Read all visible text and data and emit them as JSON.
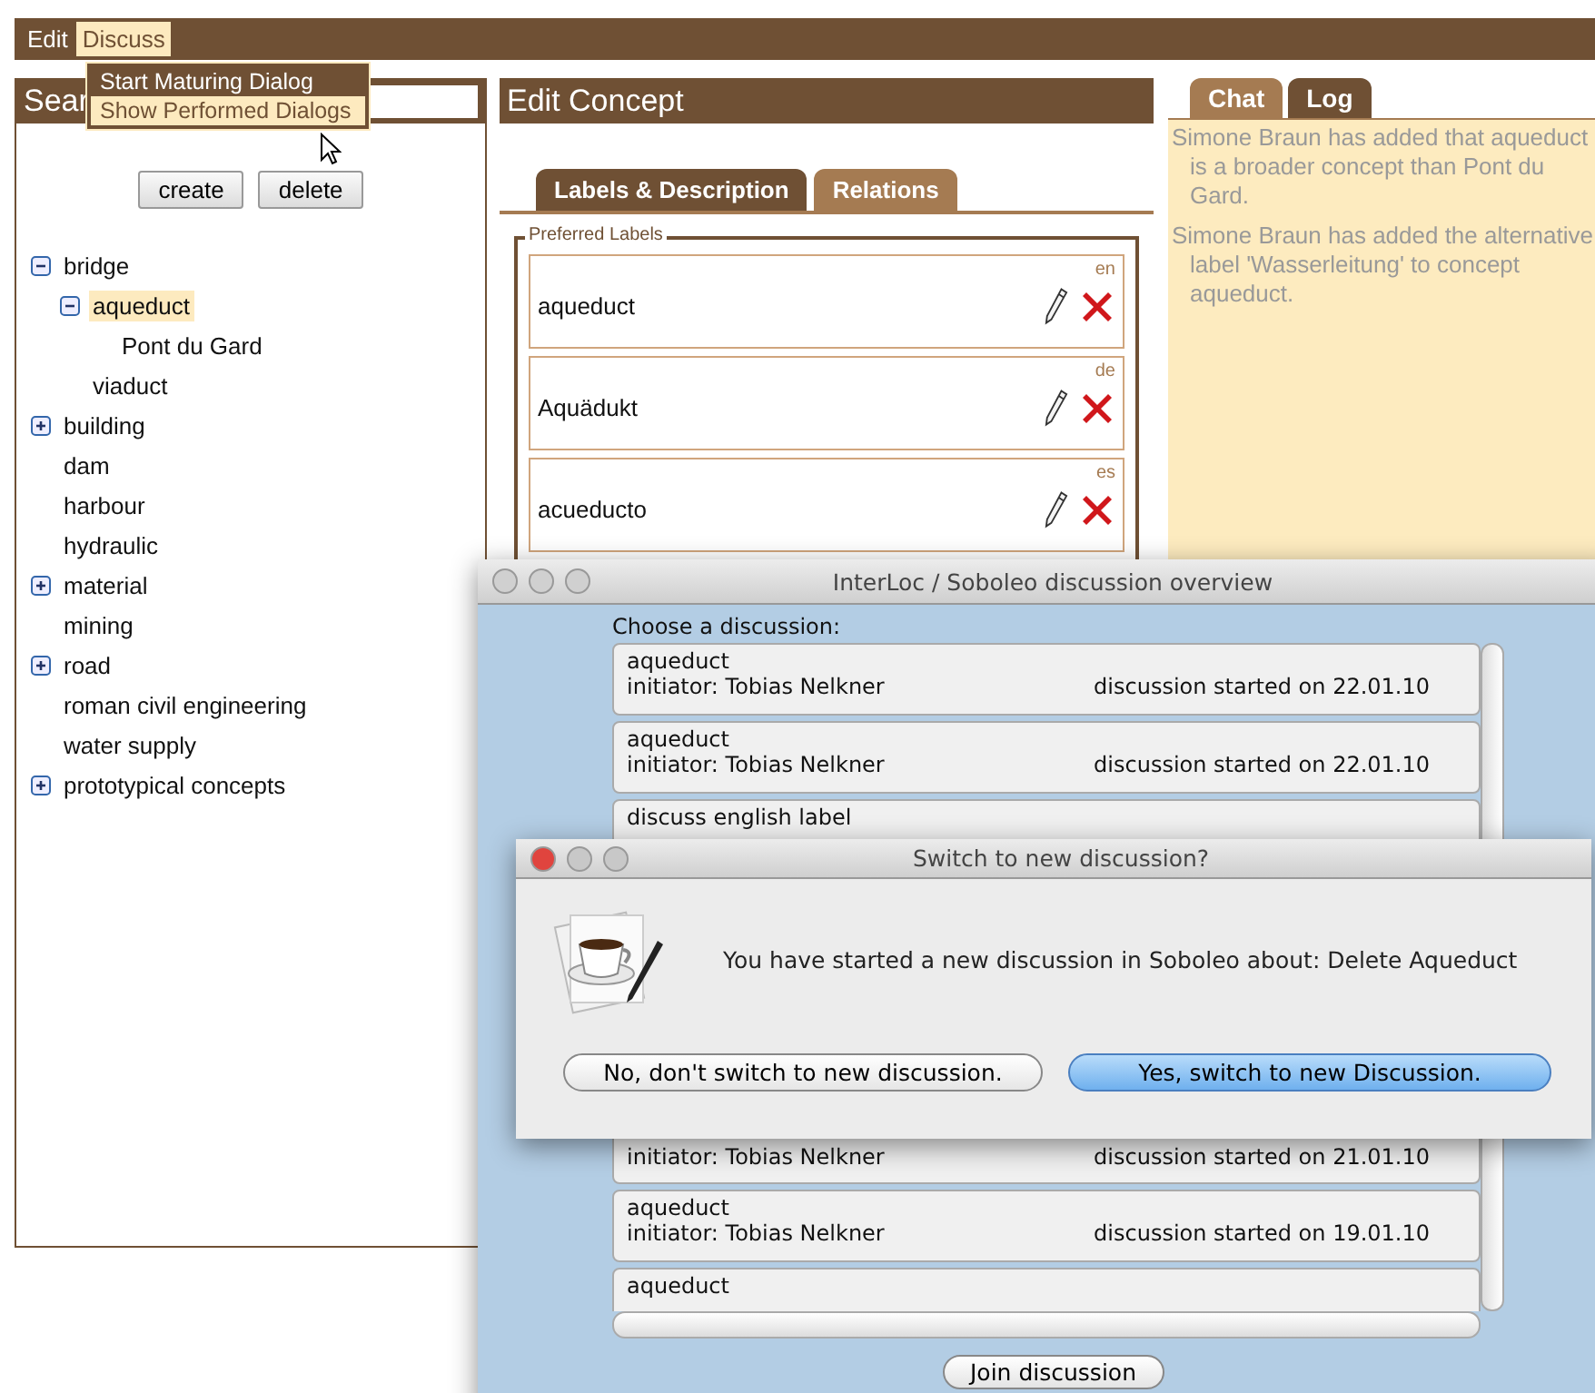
{
  "menu_bar": {
    "items": [
      {
        "label": "Edit",
        "selected": false
      },
      {
        "label": "Discuss",
        "selected": true
      }
    ]
  },
  "dropdown": {
    "items": [
      {
        "label": "Start Maturing Dialog",
        "selected": false
      },
      {
        "label": "Show Performed Dialogs",
        "selected": true
      }
    ]
  },
  "search_panel": {
    "title": "Sear",
    "buttons": [
      "create",
      "delete"
    ],
    "tree": [
      {
        "label": "bridge",
        "expanded": true,
        "selected": false,
        "children": [
          {
            "label": "aqueduct",
            "expanded": true,
            "selected": true,
            "children": [
              {
                "label": "Pont du Gard",
                "selected": false
              }
            ]
          },
          {
            "label": "viaduct",
            "selected": false
          }
        ]
      },
      {
        "label": "building",
        "expanded": false,
        "selected": false
      },
      {
        "label": "dam",
        "selected": false
      },
      {
        "label": "harbour",
        "selected": false
      },
      {
        "label": "hydraulic",
        "selected": false
      },
      {
        "label": "material",
        "expanded": false,
        "selected": false
      },
      {
        "label": "mining",
        "selected": false
      },
      {
        "label": "road",
        "expanded": false,
        "selected": false
      },
      {
        "label": "roman civil engineering",
        "selected": false
      },
      {
        "label": "water supply",
        "selected": false
      },
      {
        "label": "prototypical concepts",
        "expanded": false,
        "selected": false
      }
    ]
  },
  "concept_panel": {
    "title": "Edit Concept",
    "tabs": [
      {
        "label": "Labels & Description",
        "selected": true
      },
      {
        "label": "Relations",
        "selected": false
      }
    ],
    "fieldset": "Preferred Labels",
    "labels": [
      {
        "lang": "en",
        "text": "aqueduct"
      },
      {
        "lang": "de",
        "text": "Aquädukt"
      },
      {
        "lang": "es",
        "text": "acueducto"
      }
    ]
  },
  "side_panel": {
    "tabs": [
      {
        "label": "Chat",
        "selected": false
      },
      {
        "label": "Log",
        "selected": true
      }
    ],
    "messages": [
      "Simone Braun has added that aqueduct is a broader concept than Pont du Gard.",
      "Simone Braun has added the alternative label 'Wasserleitung' to concept aqueduct."
    ]
  },
  "overview_window": {
    "title": "InterLoc / Soboleo discussion overview",
    "active": false,
    "prompt": "Choose a discussion:",
    "discussions_top": [
      {
        "title": "aqueduct",
        "initiator": "initiator: Tobias Nelkner",
        "started": "discussion started on 22.01.10"
      },
      {
        "title": "aqueduct",
        "initiator": "initiator: Tobias Nelkner",
        "started": "discussion started on 22.01.10"
      },
      {
        "title": "discuss english label"
      }
    ],
    "discussions_bottom": [
      {
        "initiator": "initiator: Tobias Nelkner",
        "started": "discussion started on 21.01.10"
      },
      {
        "title": "aqueduct",
        "initiator": "initiator: Tobias Nelkner",
        "started": "discussion started on 19.01.10"
      },
      {
        "title": "aqueduct"
      }
    ],
    "button": "Join discussion"
  },
  "dialog": {
    "title": "Switch to new discussion?",
    "active": true,
    "message": "You have started a new discussion in Soboleo about: Delete Aqueduct",
    "buttons": [
      {
        "label": "No, don't switch to new discussion.",
        "selected": false
      },
      {
        "label": "Yes, switch to new Discussion.",
        "selected": true
      }
    ]
  }
}
